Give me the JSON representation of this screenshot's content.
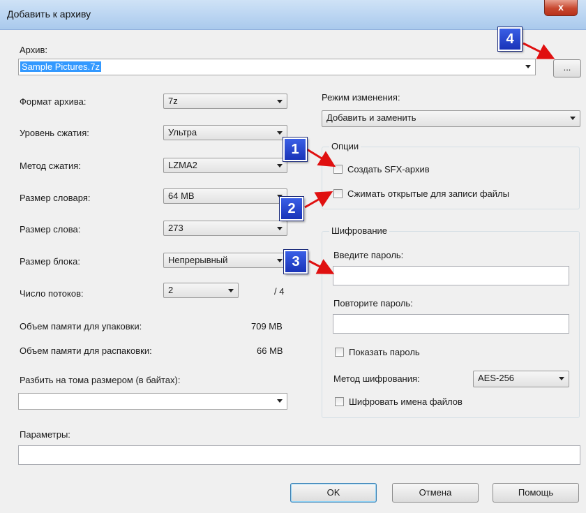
{
  "window": {
    "title": "Добавить к архиву",
    "close_glyph": "x"
  },
  "archive": {
    "label": "Архив:",
    "value": "Sample Pictures.7z",
    "browse_label": "..."
  },
  "left": {
    "format": {
      "label": "Формат архива:",
      "value": "7z"
    },
    "level": {
      "label": "Уровень сжатия:",
      "value": "Ультра"
    },
    "method": {
      "label": "Метод сжатия:",
      "value": "LZMA2"
    },
    "dict": {
      "label": "Размер словаря:",
      "value": "64 MB"
    },
    "word": {
      "label": "Размер слова:",
      "value": "273"
    },
    "block": {
      "label": "Размер блока:",
      "value": "Непрерывный"
    },
    "threads": {
      "label": "Число потоков:",
      "value": "2",
      "max": "/ 4"
    },
    "mem_pack": {
      "label": "Объем памяти для упаковки:",
      "value": "709 MB"
    },
    "mem_unpack": {
      "label": "Объем памяти для распаковки:",
      "value": "66 MB"
    },
    "split": {
      "label": "Разбить на тома размером (в байтах):",
      "value": ""
    }
  },
  "right": {
    "mode": {
      "label": "Режим изменения:",
      "value": "Добавить и заменить"
    },
    "options": {
      "title": "Опции",
      "sfx": "Создать SFX-архив",
      "compress_open": "Сжимать открытые для записи файлы"
    },
    "encryption": {
      "title": "Шифрование",
      "password_label": "Введите пароль:",
      "repeat_label": "Повторите пароль:",
      "show_password": "Показать пароль",
      "method_label": "Метод шифрования:",
      "method_value": "AES-256",
      "encrypt_names": "Шифровать имена файлов"
    }
  },
  "params": {
    "label": "Параметры:",
    "value": ""
  },
  "buttons": {
    "ok": "OK",
    "cancel": "Отмена",
    "help": "Помощь"
  },
  "callouts": [
    "1",
    "2",
    "3",
    "4"
  ],
  "colors": {
    "callout": "#1f3fd0",
    "arrow": "#e01010",
    "selection": "#3399ff"
  }
}
